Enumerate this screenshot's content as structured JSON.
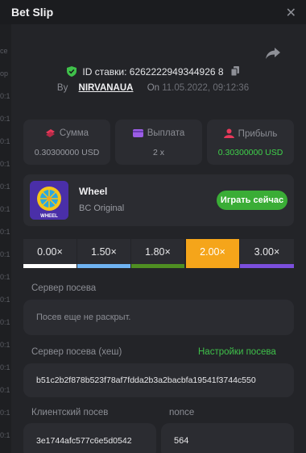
{
  "header": {
    "title": "Bet Slip"
  },
  "bet": {
    "id_text": "ID ставки: 6262222949344926 8",
    "by_label": "By",
    "user": "NIRVANAUA",
    "on_label": "On",
    "date": "11.05.2022, 09:12:36"
  },
  "stats": [
    {
      "label": "Сумма",
      "value": "0.30300000 USD"
    },
    {
      "label": "Выплата",
      "value": "2 x"
    },
    {
      "label": "Прибыль",
      "value": "0.30300000 USD"
    }
  ],
  "game": {
    "name": "Wheel",
    "provider": "BC Original",
    "play_label": "Играть сейчас",
    "thumb_text": "WHEEL"
  },
  "multipliers": [
    {
      "label": "0.00×",
      "color": "#ffffff"
    },
    {
      "label": "1.50×",
      "color": "#6fb3f2"
    },
    {
      "label": "1.80×",
      "color": "#4f8f22"
    },
    {
      "label": "2.00×",
      "color": "#f5a51a"
    },
    {
      "label": "3.00×",
      "color": "#7b4fdc"
    }
  ],
  "seed": {
    "server_label": "Сервер посева",
    "server_value": "Посев еще не раскрыт.",
    "hash_label": "Сервер посева (хеш)",
    "settings_link": "Настройки посева",
    "hash_value": "b51c2b2f878b523f78af7fdda2b3a2bacbfa19541f3744c550",
    "client_label": "Клиентский посев",
    "client_value": "3e1744afc577c6e5d0542",
    "nonce_label": "nonce",
    "nonce_value": "564"
  },
  "sidebar_ticks": [
    "ce",
    "op",
    "0:1",
    "0:1",
    "0:1",
    "0:1",
    "0:1",
    "0:1",
    "0:1",
    "0:1",
    "0:1",
    "0:1",
    "0:1",
    "0:1",
    "0:1",
    "0:1",
    "0:1",
    "0:1"
  ]
}
